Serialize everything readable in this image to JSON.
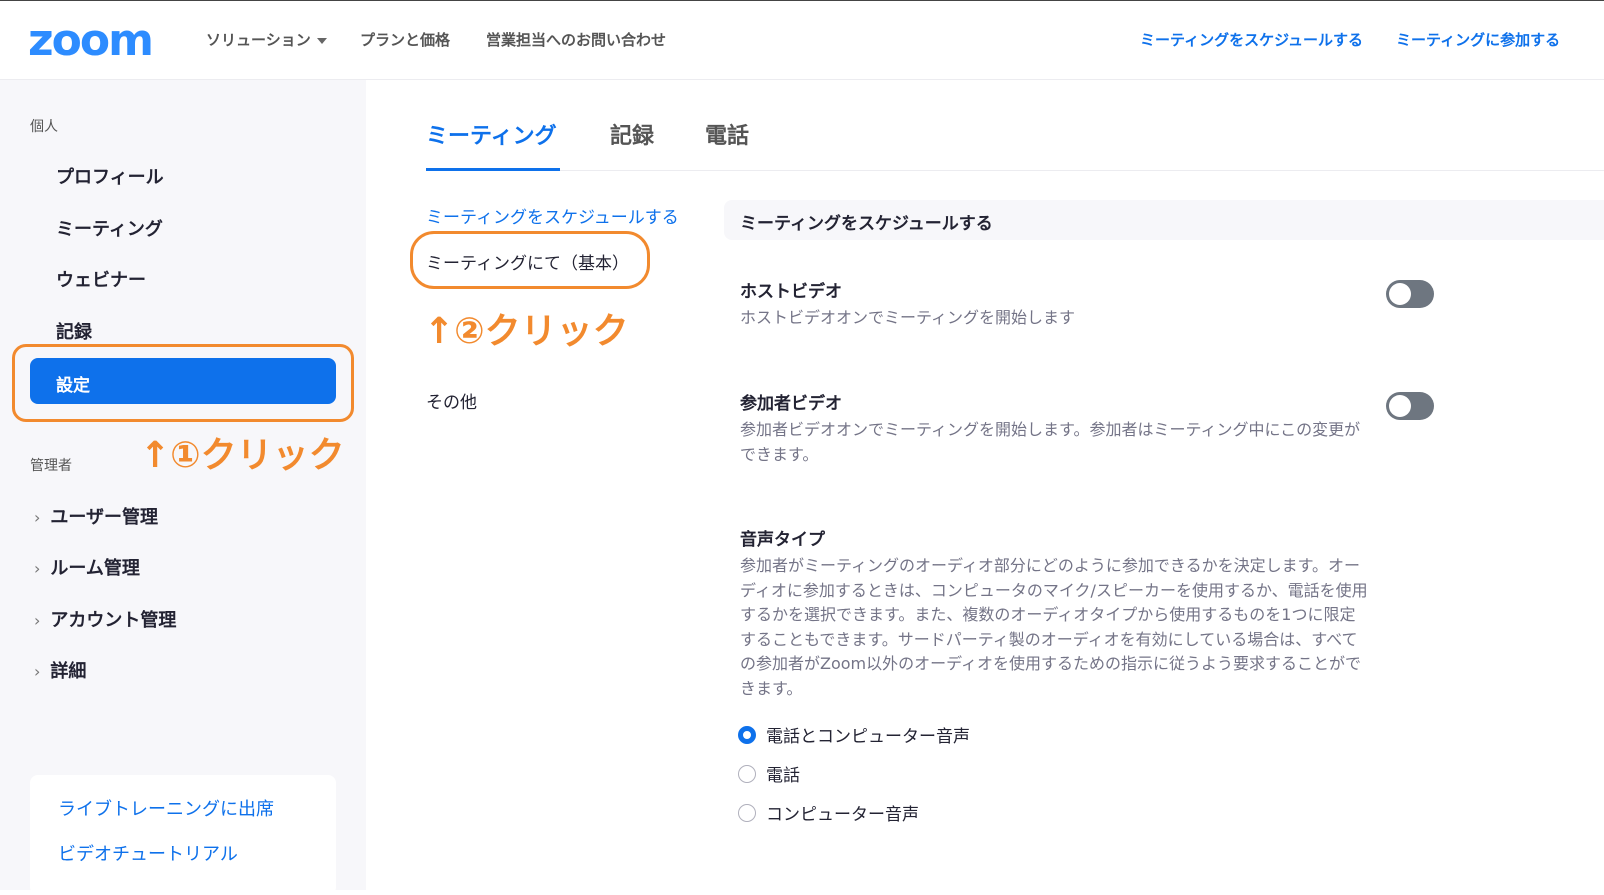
{
  "header": {
    "logo": "zoom",
    "nav": [
      "ソリューション",
      "プランと価格",
      "営業担当へのお問い合わせ"
    ],
    "right_links": [
      "ミーティングをスケジュールする",
      "ミーティングに参加する"
    ]
  },
  "sidebar": {
    "personal_label": "個人",
    "personal_items": [
      "プロフィール",
      "ミーティング",
      "ウェビナー",
      "記録",
      "設定"
    ],
    "admin_label": "管理者",
    "admin_items": [
      "ユーザー管理",
      "ルーム管理",
      "アカウント管理",
      "詳細"
    ],
    "help_links": [
      "ライブトレーニングに出席",
      "ビデオチュートリアル"
    ]
  },
  "annotations": {
    "step1": "↑①クリック",
    "step2": "↑②クリック"
  },
  "tabs": [
    "ミーティング",
    "記録",
    "電話"
  ],
  "subnav": [
    "ミーティングをスケジュールする",
    "ミーティングにて（基本）",
    "その他"
  ],
  "section_header": "ミーティングをスケジュールする",
  "settings": [
    {
      "title": "ホストビデオ",
      "desc": "ホストビデオオンでミーティングを開始します",
      "enabled": false
    },
    {
      "title": "参加者ビデオ",
      "desc": "参加者ビデオオンでミーティングを開始します。参加者はミーティング中にこの変更ができます。",
      "enabled": false
    }
  ],
  "audio": {
    "title": "音声タイプ",
    "desc": "参加者がミーティングのオーディオ部分にどのように参加できるかを決定します。オーディオに参加するときは、コンピュータのマイク/スピーカーを使用するか、電話を使用するかを選択できます。また、複数のオーディオタイプから使用するものを1つに限定することもできます。サードパーティ製のオーディオを有効にしている場合は、すべての参加者がZoom以外のオーディオを使用するための指示に従うよう要求することができます。",
    "options": [
      "電話とコンピューター音声",
      "電話",
      "コンピューター音声"
    ],
    "selected": "電話とコンピューター音声"
  },
  "colors": {
    "accent": "#0e71eb",
    "annotation": "#f28a2e"
  }
}
